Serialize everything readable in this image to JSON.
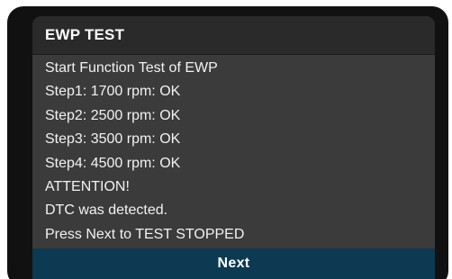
{
  "dialog": {
    "title": "EWP TEST",
    "lines": [
      "Start Function Test of EWP",
      "Step1: 1700 rpm: OK",
      "Step2: 2500 rpm: OK",
      "Step3: 3500 rpm: OK",
      "Step4: 4500 rpm: OK",
      "ATTENTION!",
      "DTC was detected.",
      "Press Next to TEST STOPPED"
    ],
    "next_label": "Next"
  },
  "colors": {
    "title_bar": "#2a2a2a",
    "dialog_body": "#3b3b3b",
    "next_button": "#0c3a52",
    "text": "#ffffff"
  }
}
